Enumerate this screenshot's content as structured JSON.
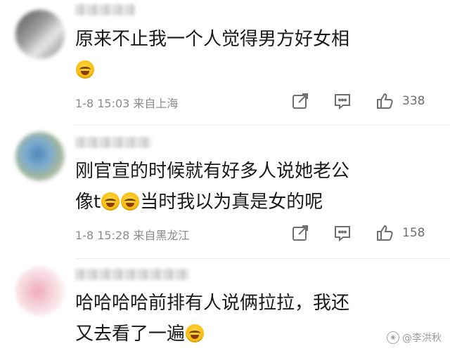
{
  "comments": [
    {
      "line1": "原来不止我一个人觉得男方好女相",
      "line2_before": "",
      "line2_after": "",
      "date": "1-8 15:03",
      "location": "来自上海",
      "likes": "338"
    },
    {
      "line1": "刚官宣的时候就有好多人说她老公",
      "line2_before": "像t",
      "line2_after": "当时我以为真是女的呢",
      "date": "1-8 15:28",
      "location": "来自黑龙江",
      "likes": "158"
    },
    {
      "line1": "哈哈哈哈前排有人说俩拉拉，我还",
      "line2_before": "又去看了一遍",
      "line2_after": ""
    }
  ],
  "watermark": "@李洪秋",
  "icons": {
    "emoji_laugh_cry": "laugh-cry-emoji-icon",
    "emoji_laugh": "laugh-emoji-icon",
    "share": "share-icon",
    "reply": "comment-icon",
    "like": "thumbs-up-icon"
  },
  "colors": {
    "text": "#1a1a1a",
    "meta": "#8a8a8a",
    "icon": "#6e6e6e"
  }
}
